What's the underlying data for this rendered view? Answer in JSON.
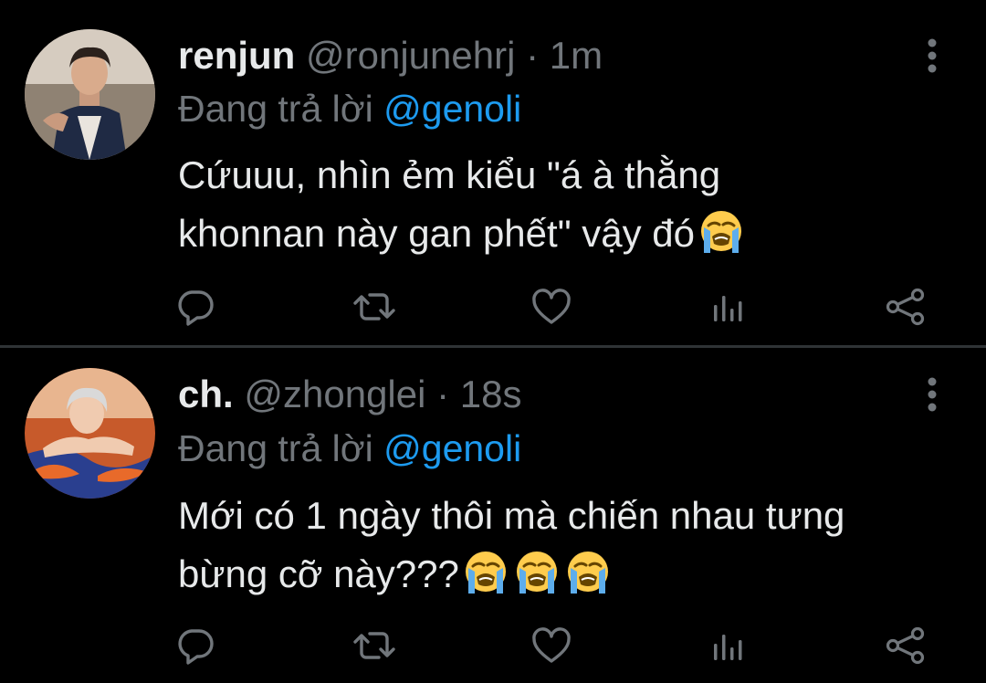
{
  "colors": {
    "background": "#000000",
    "text": "#e7e9ea",
    "secondary": "#71767b",
    "link": "#1d9bf0",
    "divider": "#2f3336"
  },
  "tweets": [
    {
      "display_name": "renjun",
      "handle": "@ronjunehrj",
      "separator": "·",
      "time": "1m",
      "reply_label": "Đang trả lời",
      "reply_to": "@genoli",
      "text_lines": [
        "Cứuuu, nhìn ẻm kiểu \"á à thằng",
        "khonnan này gan phết\" vậy đó"
      ],
      "emojis": [
        "loudly-crying-face"
      ],
      "actions": [
        "reply-icon",
        "retweet-icon",
        "like-icon",
        "analytics-icon",
        "share-icon"
      ]
    },
    {
      "display_name": "ch.",
      "handle": "@zhonglei",
      "separator": "·",
      "time": "18s",
      "reply_label": "Đang trả lời",
      "reply_to": "@genoli",
      "text_lines": [
        "Mới có 1 ngày thôi mà chiến nhau tưng",
        "bừng cỡ này???"
      ],
      "emojis": [
        "loudly-crying-face",
        "loudly-crying-face",
        "loudly-crying-face"
      ],
      "actions": [
        "reply-icon",
        "retweet-icon",
        "like-icon",
        "analytics-icon",
        "share-icon"
      ]
    }
  ]
}
